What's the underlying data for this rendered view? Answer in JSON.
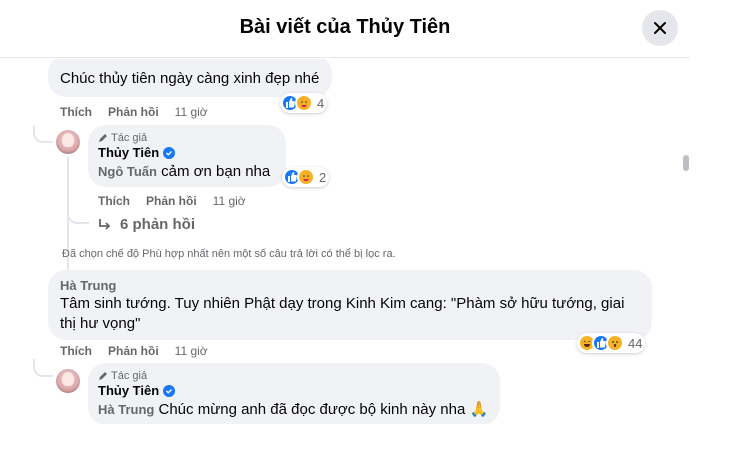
{
  "dialog": {
    "title": "Bài viết của Thủy Tiên",
    "close_icon": "close-icon"
  },
  "comments": [
    {
      "text": "Chúc thủy tiên ngày càng xinh đẹp nhé",
      "actions": {
        "like": "Thích",
        "reply": "Phản hồi",
        "time": "11 giờ"
      },
      "reactions": {
        "types": [
          "like",
          "care"
        ],
        "count": "4"
      },
      "reply": {
        "badge": "Tác giả",
        "author": "Thủy Tiên",
        "tagged": "Ngô Tuấn",
        "text": " cảm ơn bạn nha",
        "actions": {
          "like": "Thích",
          "reply": "Phản hồi",
          "time": "11 giờ"
        },
        "reactions": {
          "types": [
            "like",
            "care"
          ],
          "count": "2"
        }
      },
      "more_replies": "6 phản hồi"
    },
    {
      "author": "Hà Trung",
      "text": "Tâm sinh tướng. Tuy nhiên Phật dạy trong Kinh Kim cang: \"Phàm sở hữu tướng, giai thị hư vọng\"",
      "actions": {
        "like": "Thích",
        "reply": "Phản hồi",
        "time": "11 giờ"
      },
      "reactions": {
        "types": [
          "haha",
          "like",
          "wow"
        ],
        "count": "44"
      },
      "reply": {
        "badge": "Tác giả",
        "author": "Thủy Tiên",
        "tagged": "Hà Trung",
        "text": " Chúc mừng anh đã đọc được bộ kinh này nha 🙏"
      }
    }
  ],
  "filter_notice": "Đã chọn chế độ Phù hợp nhất nên một số câu trả lời có thể bị lọc ra.",
  "colors": {
    "accent": "#1877f2",
    "bubble": "#f0f2f5",
    "muted": "#65676b"
  }
}
